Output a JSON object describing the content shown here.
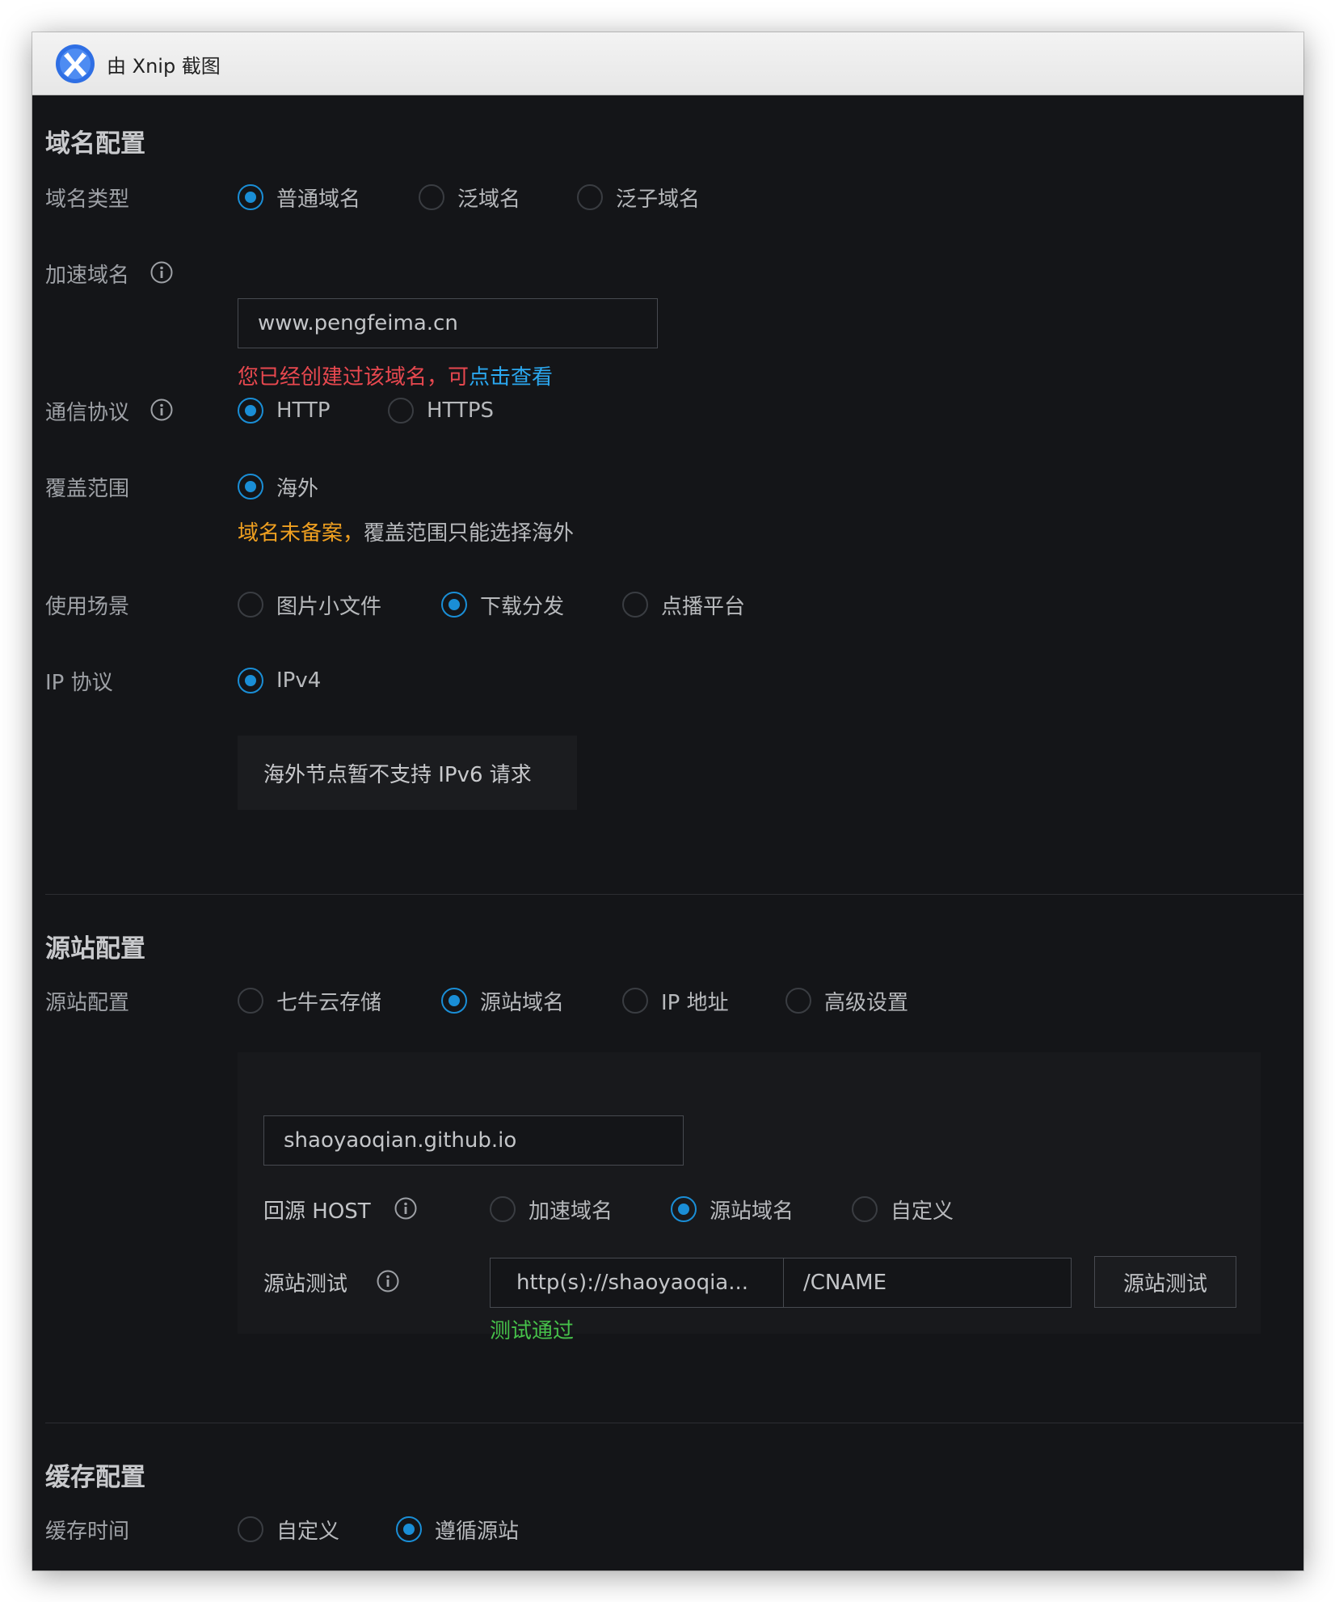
{
  "window": {
    "title": "由 Xnip 截图"
  },
  "domain_config": {
    "title": "域名配置",
    "domain_type": {
      "label": "域名类型",
      "options": [
        "普通域名",
        "泛域名",
        "泛子域名"
      ],
      "selected": "普通域名"
    },
    "accel_domain": {
      "label": "加速域名",
      "value": "www.pengfeima.cn",
      "error_text": "您已经创建过该域名，可",
      "error_link": "点击查看"
    },
    "protocol": {
      "label": "通信协议",
      "options": [
        "HTTP",
        "HTTPS"
      ],
      "selected": "HTTP"
    },
    "coverage": {
      "label": "覆盖范围",
      "options": [
        "海外"
      ],
      "selected": "海外",
      "warning_strong": "域名未备案，",
      "warning_text": "覆盖范围只能选择海外"
    },
    "scenario": {
      "label": "使用场景",
      "options": [
        "图片小文件",
        "下载分发",
        "点播平台"
      ],
      "selected": "下载分发"
    },
    "ip_protocol": {
      "label": "IP 协议",
      "options": [
        "IPv4"
      ],
      "selected": "IPv4",
      "notice": "海外节点暂不支持 IPv6 请求"
    }
  },
  "origin_config": {
    "title": "源站配置",
    "origin": {
      "label": "源站配置",
      "options": [
        "七牛云存储",
        "源站域名",
        "IP 地址",
        "高级设置"
      ],
      "selected": "源站域名"
    },
    "origin_domain_value": "shaoyaoqian.github.io",
    "back_host": {
      "label": "回源 HOST",
      "options": [
        "加速域名",
        "源站域名",
        "自定义"
      ],
      "selected": "源站域名"
    },
    "origin_test": {
      "label": "源站测试",
      "url_value": "http(s)://shaoyaoqia...",
      "path_value": "/CNAME",
      "button": "源站测试",
      "result": "测试通过"
    }
  },
  "cache_config": {
    "title": "缓存配置",
    "cache_time": {
      "label": "缓存时间",
      "options": [
        "自定义",
        "遵循源站"
      ],
      "selected": "遵循源站"
    }
  },
  "colors": {
    "background": "#141518",
    "accent": "#1a8ed6",
    "error": "#e8484f",
    "link": "#2ba8f0",
    "warning": "#f0a020",
    "success": "#46c04a"
  }
}
